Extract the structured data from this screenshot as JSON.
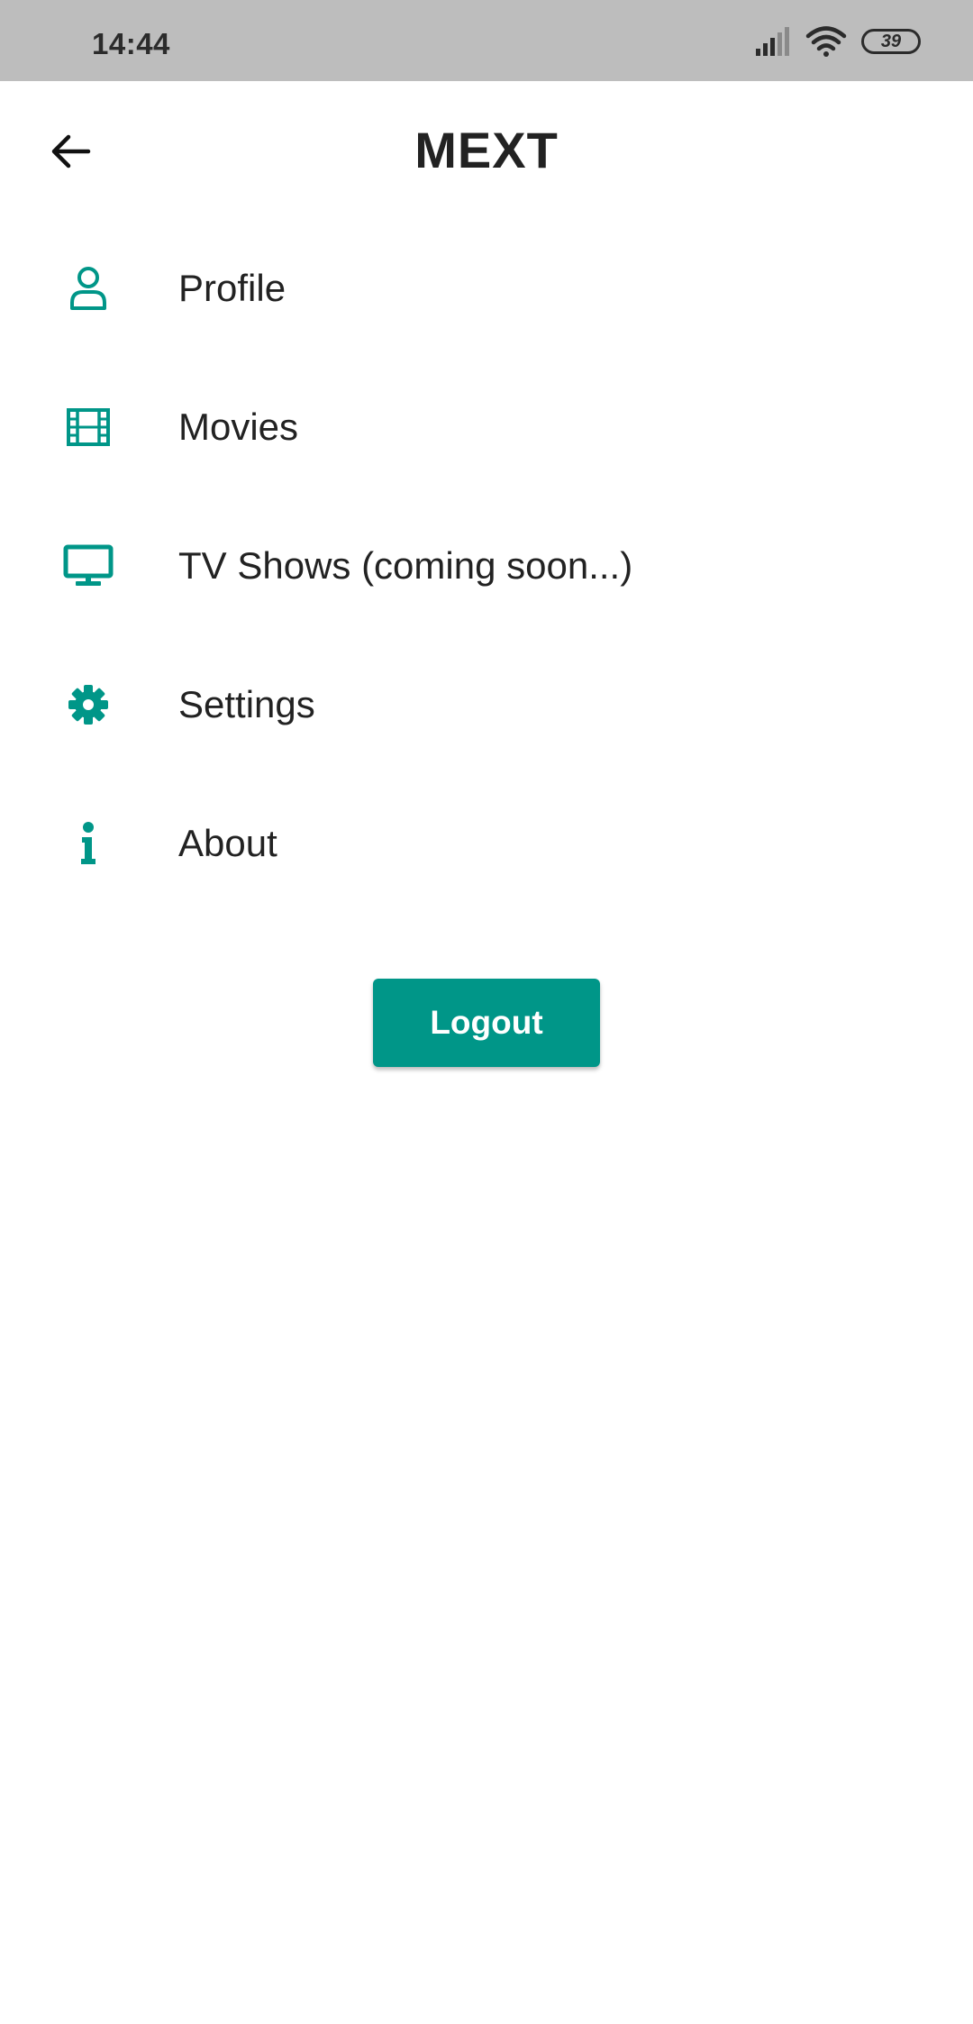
{
  "status_bar": {
    "time": "14:44",
    "battery_level": "39",
    "icons": [
      "signal-icon",
      "wifi-icon",
      "battery-icon"
    ]
  },
  "app_bar": {
    "title": "MEXT",
    "back_icon": "arrow-left-icon"
  },
  "menu": {
    "items": [
      {
        "label": "Profile",
        "icon": "person-icon"
      },
      {
        "label": "Movies",
        "icon": "film-icon"
      },
      {
        "label": "TV Shows (coming soon...)",
        "icon": "tv-icon"
      },
      {
        "label": "Settings",
        "icon": "gear-icon"
      },
      {
        "label": "About",
        "icon": "info-icon"
      }
    ]
  },
  "logout": {
    "label": "Logout"
  },
  "colors": {
    "accent": "#009688",
    "status_bar": "#bdbdbd",
    "text": "#222222",
    "background": "#ffffff"
  }
}
